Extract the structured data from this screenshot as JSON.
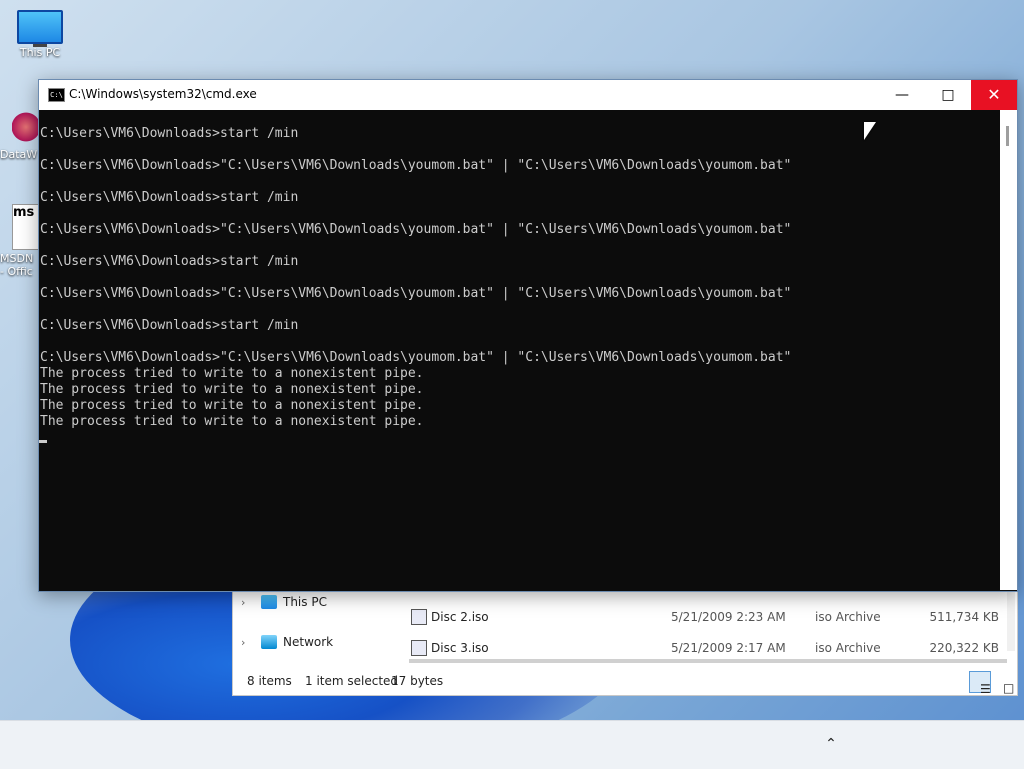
{
  "desktop": {
    "icons": [
      {
        "label": "This PC",
        "icon": "computer-icon"
      },
      {
        "label": "DataW",
        "icon": "app-shortcut-icon"
      },
      {
        "label": "MSDN",
        "label2": "- Offic",
        "badge": "ms",
        "icon": "msdn-shortcut-icon"
      }
    ]
  },
  "explorer": {
    "nav": [
      {
        "label": "This PC",
        "icon": "computer-icon"
      },
      {
        "label": "Network",
        "icon": "network-icon"
      }
    ],
    "files": [
      {
        "name": "Disc 2.iso",
        "date": "5/21/2009 2:23 AM",
        "type": "iso Archive",
        "size": "511,734 KB",
        "icon": "iso-file-icon"
      },
      {
        "name": "Disc 3.iso",
        "date": "5/21/2009 2:17 AM",
        "type": "iso Archive",
        "size": "220,322 KB",
        "icon": "iso-file-icon"
      }
    ],
    "status": {
      "items": "8 items",
      "selected": "1 item selected",
      "size": "17 bytes"
    }
  },
  "cmd": {
    "title": "C:\\Windows\\system32\\cmd.exe",
    "lines": [
      "C:\\Users\\VM6\\Downloads>start /min",
      "",
      "C:\\Users\\VM6\\Downloads>\"C:\\Users\\VM6\\Downloads\\youmom.bat\" | \"C:\\Users\\VM6\\Downloads\\youmom.bat\"",
      "",
      "C:\\Users\\VM6\\Downloads>start /min",
      "",
      "C:\\Users\\VM6\\Downloads>\"C:\\Users\\VM6\\Downloads\\youmom.bat\" | \"C:\\Users\\VM6\\Downloads\\youmom.bat\"",
      "",
      "C:\\Users\\VM6\\Downloads>start /min",
      "",
      "C:\\Users\\VM6\\Downloads>\"C:\\Users\\VM6\\Downloads\\youmom.bat\" | \"C:\\Users\\VM6\\Downloads\\youmom.bat\"",
      "",
      "C:\\Users\\VM6\\Downloads>start /min",
      "",
      "C:\\Users\\VM6\\Downloads>\"C:\\Users\\VM6\\Downloads\\youmom.bat\" | \"C:\\Users\\VM6\\Downloads\\youmom.bat\"",
      "The process tried to write to a nonexistent pipe.",
      "The process tried to write to a nonexistent pipe.",
      "The process tried to write to a nonexistent pipe.",
      "The process tried to write to a nonexistent pipe."
    ],
    "colors": {
      "background": "#0c0c0c",
      "text": "#cccccc",
      "close_hover": "#e81123"
    }
  },
  "icons": {
    "minimize": "minimize-icon",
    "maximize": "maximize-icon",
    "close": "close-icon",
    "tray_chevron": "chevron-up-icon"
  }
}
